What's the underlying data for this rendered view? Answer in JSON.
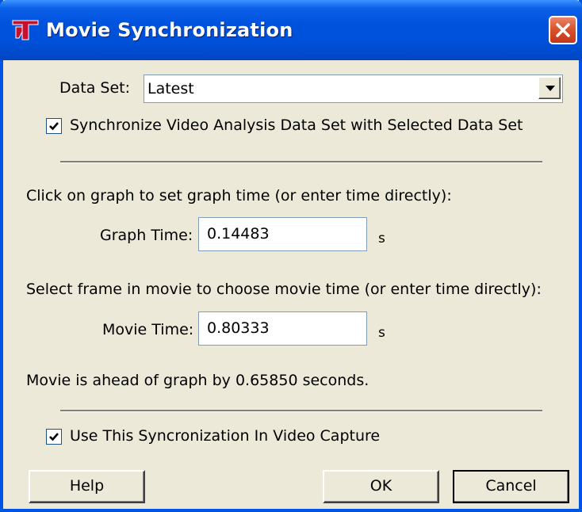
{
  "window": {
    "title": "Movie Synchronization"
  },
  "dataset": {
    "label": "Data Set:",
    "selected": "Latest",
    "sync_checkbox_label": "Synchronize Video Analysis Data Set with Selected Data Set",
    "sync_checked": true
  },
  "graph": {
    "instruction": "Click on graph to set graph time (or enter time directly):",
    "time_label": "Graph Time:",
    "time_value": "0.14483",
    "unit": "s"
  },
  "movie": {
    "instruction": "Select frame in movie to choose movie time (or enter time directly):",
    "time_label": "Movie Time:",
    "time_value": "0.80333",
    "unit": "s"
  },
  "status": {
    "message": "Movie is ahead of graph by 0.65850 seconds."
  },
  "capture": {
    "checkbox_label": "Use This Syncronization In Video Capture",
    "checked": true
  },
  "buttons": {
    "help": "Help",
    "ok": "OK",
    "cancel": "Cancel"
  },
  "colors": {
    "titlebar": "#0054e3",
    "background": "#ece9d8",
    "close": "#d9542d"
  },
  "icons": {
    "app": "app-logo-icon",
    "close": "close-icon",
    "dropdown": "chevron-down-icon",
    "check": "check-icon"
  }
}
